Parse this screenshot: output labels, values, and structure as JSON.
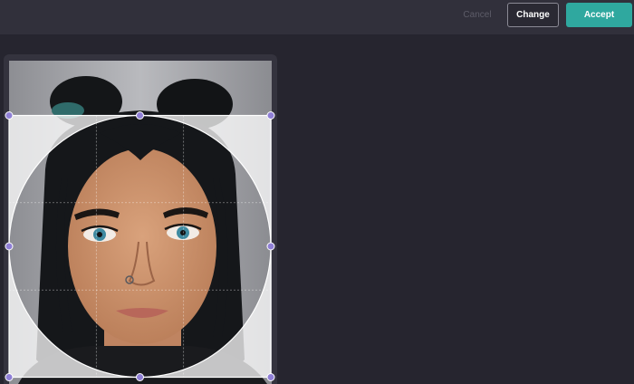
{
  "toolbar": {
    "cancel_label": "Cancel",
    "change_label": "Change",
    "accept_label": "Accept"
  },
  "crop": {
    "shape": "circle",
    "grid": "rule-of-thirds",
    "handles": [
      "top-left",
      "top-middle",
      "top-right",
      "middle-left",
      "middle-right",
      "bottom-left",
      "bottom-middle",
      "bottom-right"
    ]
  },
  "colors": {
    "background": "#26252f",
    "toolbar": "#31303b",
    "accent": "#2fa89f",
    "handle": "#8f7fd6"
  }
}
